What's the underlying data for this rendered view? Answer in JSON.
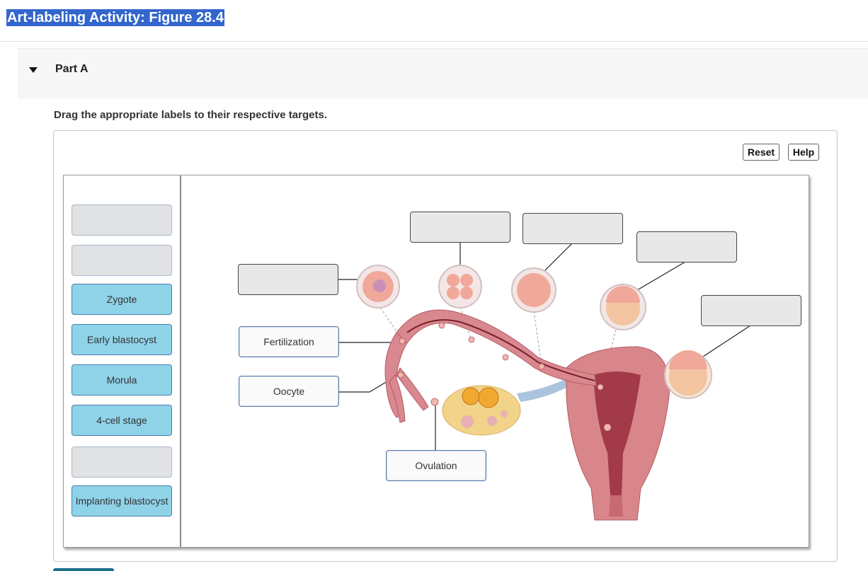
{
  "header": {
    "title": "Art-labeling Activity: Figure 28.4"
  },
  "part": {
    "label": "Part A"
  },
  "instructions": "Drag the appropriate labels to their respective targets.",
  "toolbar": {
    "reset_label": "Reset",
    "help_label": "Help"
  },
  "label_bank": [
    {
      "label": ""
    },
    {
      "label": ""
    },
    {
      "label": "Zygote"
    },
    {
      "label": "Early blastocyst"
    },
    {
      "label": "Morula"
    },
    {
      "label": "4-cell stage"
    },
    {
      "label": ""
    },
    {
      "label": "Implanting blastocyst"
    }
  ],
  "placed_labels": {
    "fertilization": "Fertilization",
    "oocyte": "Oocyte",
    "ovulation": "Ovulation"
  },
  "colors": {
    "title_bg": "#3366cc",
    "bank_filled": "#8fd3e8",
    "tissue": "#d9868a"
  }
}
